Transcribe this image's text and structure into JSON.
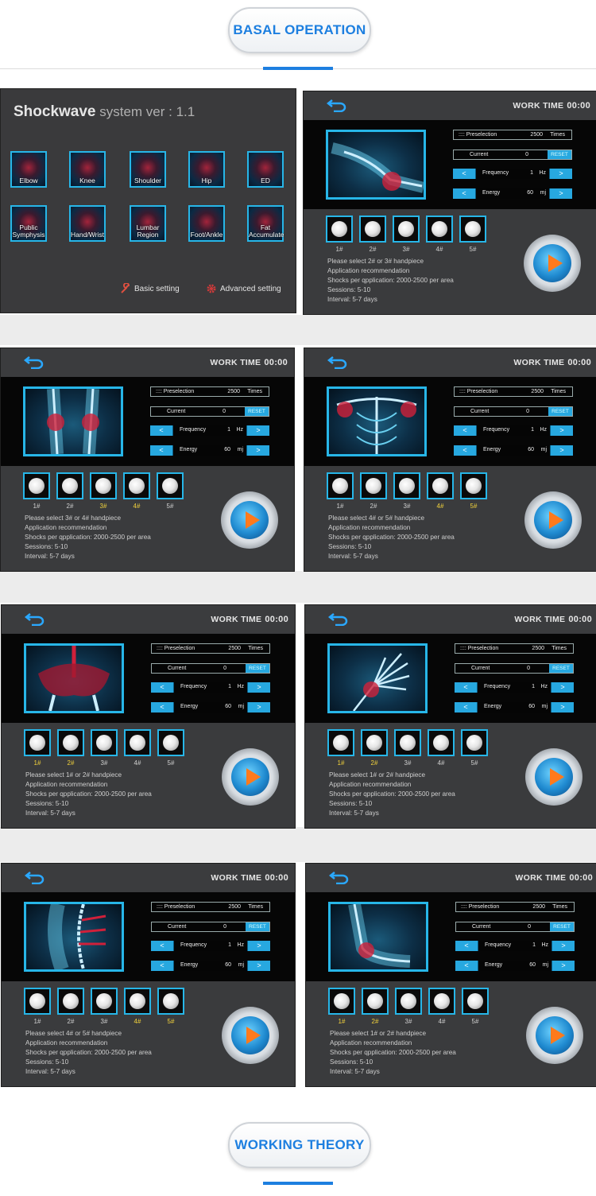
{
  "sections": {
    "basal_title": "BASAL OPERATION",
    "theory_title": "WORKING THEORY"
  },
  "home": {
    "brand": "Shockwave",
    "version": " system ver : 1.1",
    "buttons": [
      "Elbow",
      "Knee",
      "Shoulder",
      "Hip",
      "ED",
      "Public Symphysis",
      "Hand/Wrist",
      "Lumbar Region",
      "Foot/Ankle",
      "Fat Accumulate"
    ],
    "basic_setting": "Basic setting",
    "advanced_setting": "Advanced setting"
  },
  "common": {
    "work_time_label": "WORK TIME",
    "work_time_value": "00:00",
    "preselection_label": ":::: Preselection",
    "preselection_value": "2500",
    "preselection_unit": "Times",
    "current_label": "Current",
    "current_value": "0",
    "reset_label": "RESET",
    "frequency_label": "Frequency",
    "frequency_value": "1",
    "frequency_unit": "Hz",
    "energy_label": "Energy",
    "energy_value": "60",
    "energy_unit": "mj",
    "handpieces": [
      "1#",
      "2#",
      "3#",
      "4#",
      "5#"
    ],
    "app_rec": "Application recommendation",
    "shocks": "Shocks per qpplication:  2000-2500 per area",
    "sessions": "Sessions:  5-10",
    "interval": "Interval:  5-7 days",
    "arrow_left": "<",
    "arrow_right": ">"
  },
  "screens": [
    {
      "name": "elbow",
      "select_text": "Please select 2# or 3# handpiece",
      "highlight": []
    },
    {
      "name": "knee",
      "select_text": "Please select 3# or 4# handpiece",
      "highlight": [
        2,
        3
      ]
    },
    {
      "name": "shoulder",
      "select_text": "Please select 4# or 5# handpiece",
      "highlight": [
        3,
        4
      ]
    },
    {
      "name": "hip",
      "select_text": "Please select 1# or 2# handpiece",
      "highlight": [
        0,
        1
      ]
    },
    {
      "name": "hand",
      "select_text": "Please select 1# or 2# handpiece",
      "highlight": [
        0,
        1
      ]
    },
    {
      "name": "lumbar",
      "select_text": "Please select 4# or 5# handpiece",
      "highlight": [
        3,
        4
      ]
    },
    {
      "name": "foot",
      "select_text": "Please select 1# or 2# handpiece",
      "highlight": [
        0,
        1
      ]
    }
  ],
  "colors": {
    "accent": "#27b6e8",
    "title_blue": "#1d7fe0",
    "highlight": "#f2d23c",
    "play": "#ff7a1c"
  }
}
